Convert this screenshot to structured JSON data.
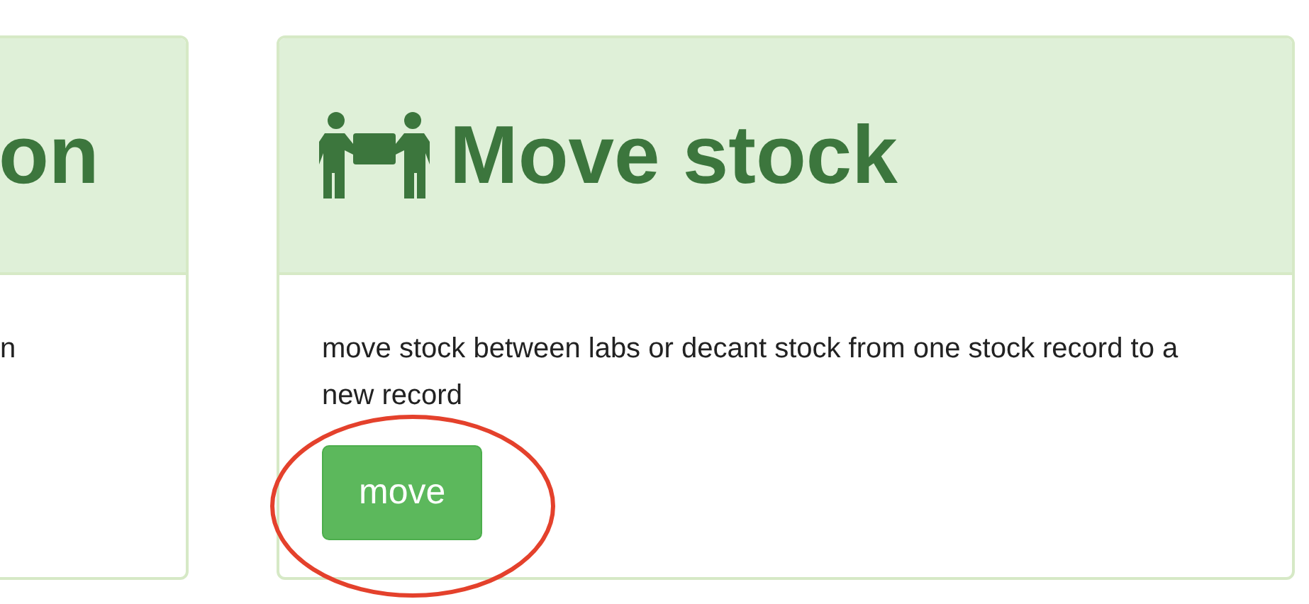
{
  "cards": [
    {
      "title": "on",
      "description": "n",
      "kind": "partial"
    },
    {
      "title": "Move stock",
      "description": "move stock between labs or decant stock from one stock record to a new record",
      "button": "move",
      "kind": "full",
      "highlight": {
        "color": "#e4412c"
      }
    }
  ]
}
